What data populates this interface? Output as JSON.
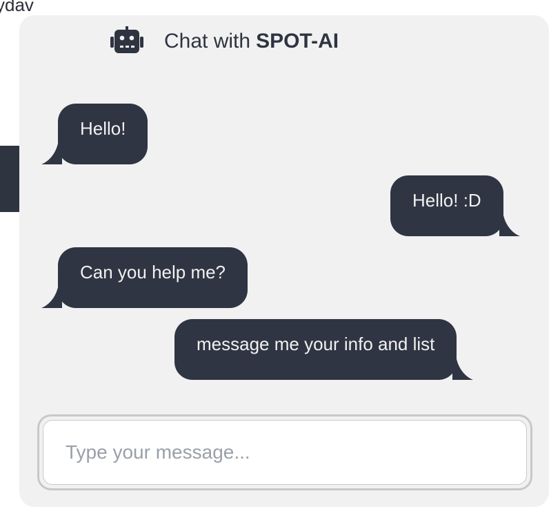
{
  "background": {
    "partial_text": "ydav"
  },
  "chat": {
    "title_prefix": "Chat with",
    "title_brand": "SPOT-AI",
    "icon": "robot-icon",
    "messages": [
      {
        "sender": "bot",
        "text": "Hello!"
      },
      {
        "sender": "user",
        "text": "Hello! :D"
      },
      {
        "sender": "bot",
        "text": "Can you help me?"
      },
      {
        "sender": "user",
        "text": "message me your info and list"
      }
    ],
    "input": {
      "placeholder": "Type your message...",
      "value": ""
    }
  },
  "colors": {
    "panel_bg": "#f1f1f1",
    "bubble_bg": "#2f3542",
    "bubble_text": "#f1f1f1",
    "title_text": "#2e3440"
  }
}
